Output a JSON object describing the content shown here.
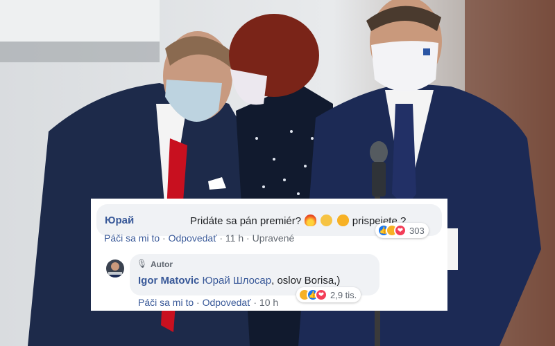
{
  "comment1": {
    "author": "Юрай",
    "text_before": "Pridáte sa pán premiér?",
    "text_after": "prispejete ?",
    "emojis": [
      "fire",
      "clapping-hands",
      "star-struck"
    ],
    "like_label": "Páči sa mi to",
    "reply_label": "Odpovedať",
    "time": "11 h",
    "edited_label": "Upravené",
    "reactions": [
      "like",
      "haha",
      "love"
    ],
    "reaction_count": "303"
  },
  "comment2": {
    "badge": "Autor",
    "author": "Igor Matovic",
    "mention": "Юрай Шлосар",
    "text": ", oslov Borisa,)",
    "like_label": "Páči sa mi to",
    "reply_label": "Odpovedať",
    "time": "10 h",
    "reactions": [
      "haha",
      "like",
      "love"
    ],
    "reaction_count": "2,9 tis."
  },
  "colors": {
    "link": "#385898",
    "bubble": "#f0f2f5",
    "like": "#1877f2",
    "love": "#f33e58",
    "haha": "#f7b125"
  }
}
